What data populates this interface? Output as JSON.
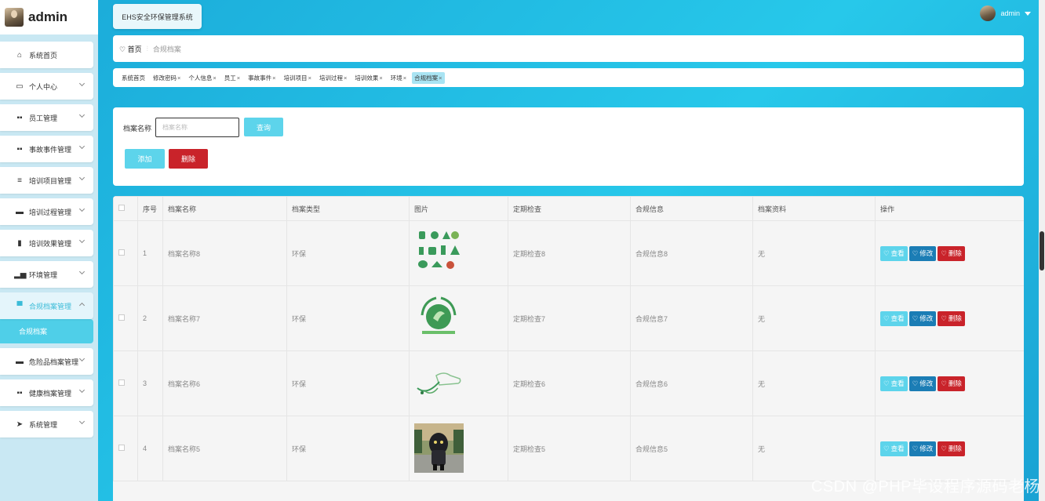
{
  "sidebar": {
    "title": "admin",
    "menu": [
      {
        "label": "系统首页",
        "icon": "home-icon",
        "glyph": "⌂",
        "chev": false
      },
      {
        "label": "个人中心",
        "icon": "id-card-icon",
        "glyph": "▭",
        "chev": true
      },
      {
        "label": "员工管理",
        "icon": "grid-icon",
        "glyph": "▪▪",
        "chev": true
      },
      {
        "label": "事故事件管理",
        "icon": "grid-icon",
        "glyph": "▪▪",
        "chev": true
      },
      {
        "label": "培训项目管理",
        "icon": "list-icon",
        "glyph": "≡",
        "chev": true
      },
      {
        "label": "培训过程管理",
        "icon": "briefcase-icon",
        "glyph": "▬",
        "chev": true
      },
      {
        "label": "培训效果管理",
        "icon": "clipboard-icon",
        "glyph": "▮",
        "chev": true
      },
      {
        "label": "环境管理",
        "icon": "bar-chart-icon",
        "glyph": "▂▅",
        "chev": true
      },
      {
        "label": "合规档案管理",
        "icon": "monitor-icon",
        "glyph": "▀",
        "chev": true,
        "open": true,
        "sub": "合规档案"
      },
      {
        "label": "危险品档案管理",
        "icon": "chat-icon",
        "glyph": "▬",
        "chev": true
      },
      {
        "label": "健康档案管理",
        "icon": "grid-icon",
        "glyph": "▪▪",
        "chev": true
      },
      {
        "label": "系统管理",
        "icon": "send-icon",
        "glyph": "➤",
        "chev": true
      }
    ]
  },
  "header": {
    "app_title": "EHS安全环保管理系统",
    "user": "admin"
  },
  "breadcrumb": {
    "home": "首页",
    "current": "合规档案"
  },
  "tabs": [
    {
      "label": "系统首页",
      "close": false
    },
    {
      "label": "修改密码",
      "close": true
    },
    {
      "label": "个人信息",
      "close": true
    },
    {
      "label": "员工",
      "close": true
    },
    {
      "label": "事故事件",
      "close": true
    },
    {
      "label": "培训项目",
      "close": true
    },
    {
      "label": "培训过程",
      "close": true
    },
    {
      "label": "培训效果",
      "close": true
    },
    {
      "label": "环境",
      "close": true
    },
    {
      "label": "合规档案",
      "close": true,
      "active": true
    }
  ],
  "search": {
    "label": "档案名称",
    "placeholder": "档案名称",
    "query_btn": "查询",
    "add_btn": "添加",
    "delete_btn": "删除"
  },
  "table": {
    "columns": [
      "序号",
      "档案名称",
      "档案类型",
      "图片",
      "定期检查",
      "合规信息",
      "档案资料",
      "操作"
    ],
    "rows": [
      {
        "no": "1",
        "name": "档案名称8",
        "type": "环保",
        "image": "eco-icons-image",
        "check": "定期检查8",
        "info": "合规信息8",
        "file": "无"
      },
      {
        "no": "2",
        "name": "档案名称7",
        "type": "环保",
        "image": "eco-emblem-image",
        "check": "定期检查7",
        "info": "合规信息7",
        "file": "无"
      },
      {
        "no": "3",
        "name": "档案名称6",
        "type": "环保",
        "image": "ev-charging-image",
        "check": "定期检查6",
        "info": "合规信息6",
        "file": "无"
      },
      {
        "no": "4",
        "name": "档案名称5",
        "type": "环保",
        "image": "mascot-photo-image",
        "check": "定期检查5",
        "info": "合规信息5",
        "file": "无"
      }
    ],
    "ops": {
      "view": "查看",
      "edit": "修改",
      "del": "删除"
    }
  },
  "watermark": "CSDN @PHP毕设程序源码老杨",
  "colors": {
    "accent": "#5dd4eb",
    "danger": "#c9232a",
    "primary": "#1b7db5"
  }
}
